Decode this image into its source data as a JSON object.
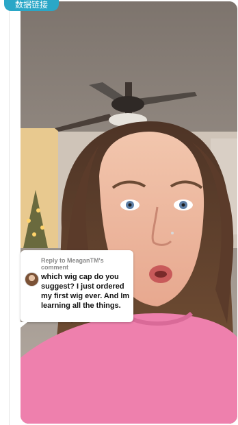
{
  "badge": {
    "label": "数据链接",
    "color": "#2aa7c7"
  },
  "video": {
    "scene_description_icon": "video-frame",
    "shirt_color": "#ee80ad"
  },
  "comment_reply": {
    "reply_prefix": "Reply to MeaganTM's comment",
    "text": "which wig cap do you suggest? I just ordered my first wig ever. And Im learning all the things."
  }
}
